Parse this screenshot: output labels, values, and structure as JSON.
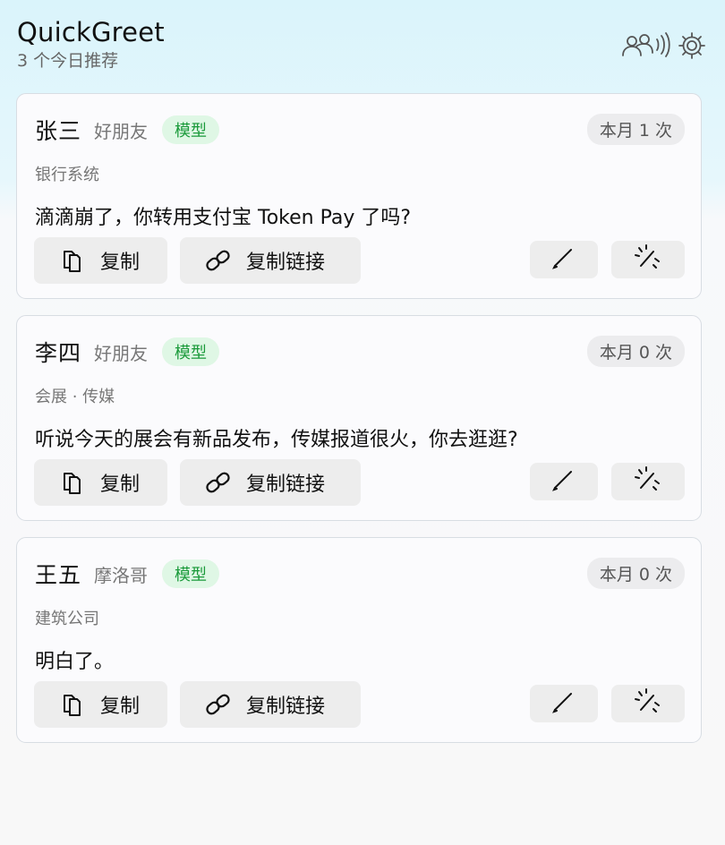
{
  "header": {
    "title": "QuickGreet",
    "subtitle": "3 个今日推荐",
    "icons": [
      "people-broadcast-icon",
      "gear-icon"
    ]
  },
  "cards": [
    {
      "name": "张三",
      "relation": "好朋友",
      "badge": "模型",
      "usage": "本月 1 次",
      "tags": "银行系统",
      "message": "滴滴崩了，你转用支付宝 Token Pay 了吗?",
      "copy_label": "复制",
      "copy_link_label": "复制链接"
    },
    {
      "name": "李四",
      "relation": "好朋友",
      "badge": "模型",
      "usage": "本月 0 次",
      "tags": "会展 ·  传媒",
      "message": "听说今天的展会有新品发布，传媒报道很火，你去逛逛?",
      "copy_label": "复制",
      "copy_link_label": "复制链接"
    },
    {
      "name": "王五",
      "relation": "摩洛哥",
      "badge": "模型",
      "usage": "本月 0 次",
      "tags": "建筑公司",
      "message": "明白了。",
      "copy_label": "复制",
      "copy_link_label": "复制链接"
    }
  ],
  "colors": {
    "badge_bg": "#dff7e5",
    "badge_text": "#1a9a3a",
    "header_bg": "#daf4fb"
  }
}
